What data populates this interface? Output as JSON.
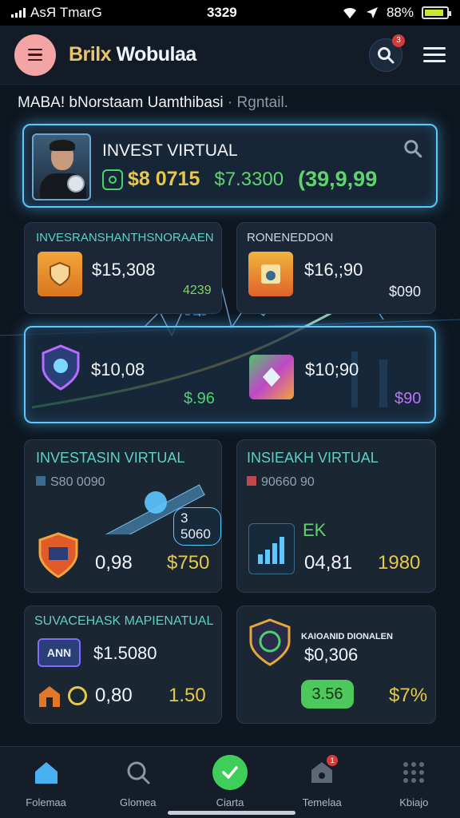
{
  "status_bar": {
    "carrier": "AsЯ TmarG",
    "time": "3329",
    "battery": "88%"
  },
  "header": {
    "title_brand": "Brilx",
    "title_rest": " Wobulaa",
    "notification_count": "3"
  },
  "subtitle": {
    "main": "MABA! bNorstaam Uamthibasi",
    "muted": " · Rgntail."
  },
  "invest_card": {
    "title": "INVEST VIRTUAL",
    "amount1": "$8 0715",
    "amount2": "$7.3300",
    "amount3": "(39,9,99"
  },
  "tile_top_left": {
    "label": "INVESRANSHANTHSNORAAEN",
    "value": "$15,308",
    "chart_value": "4239"
  },
  "tile_top_right": {
    "label": "RONENEDDON",
    "value": "$16,;90",
    "side_value": "$090"
  },
  "tile_mid": {
    "value_left": "$10,08",
    "value_right": "$10;90",
    "change": "$.96",
    "side_value": "$90"
  },
  "tile_invest_left": {
    "title": "INVESTASIN VIRTUAL",
    "sub": "S80 0090",
    "badge": "3 5060",
    "value1": "0,98",
    "value2": "$750"
  },
  "tile_invest_right": {
    "title": "INSIEAKH VIRTUAL",
    "sub": "90660 90",
    "ek_label": "EK",
    "value1": "04,81",
    "value2": "1980"
  },
  "tile_bottom_left": {
    "title": "SUVACEHASK MAPIENATUAL",
    "badge_text": "ANN",
    "value": "$1.5080",
    "value2": "0,80",
    "value3": "1.50"
  },
  "tile_bottom_right": {
    "small_label": "KAIOANID DIONALEN",
    "value": "$0,306",
    "button_label": "3.56",
    "side_value": "$7%"
  },
  "bottom_nav": [
    {
      "label": "Folemaa",
      "icon": "home-icon"
    },
    {
      "label": "Glomea",
      "icon": "search-icon"
    },
    {
      "label": "Ciarta",
      "icon": "check-icon"
    },
    {
      "label": "Temelaa",
      "icon": "bag-icon",
      "badge": "1"
    },
    {
      "label": "Kbiajo",
      "icon": "grid-icon"
    }
  ]
}
